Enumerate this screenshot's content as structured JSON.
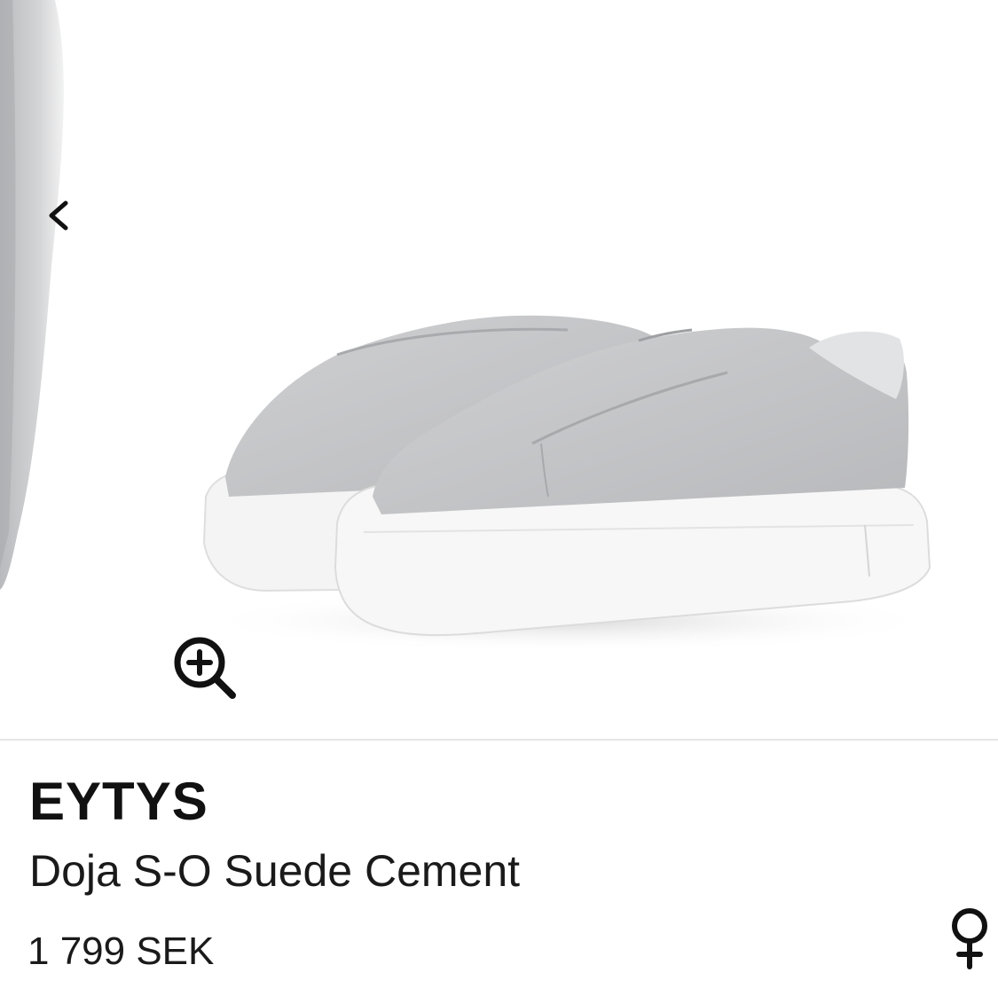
{
  "gallery": {
    "prev_icon": "chevron-left-icon",
    "zoom_icon": "zoom-in-icon",
    "image": "grey suede slip-on platform sneakers"
  },
  "product": {
    "brand": "EYTYS",
    "name": "Doja S-O Suede Cement",
    "price": "1 799 SEK",
    "gender_icon": "female-symbol-icon"
  },
  "colors": {
    "suede": "#c4c5c7",
    "sole": "#f7f7f7",
    "text": "#1a1a1a"
  }
}
